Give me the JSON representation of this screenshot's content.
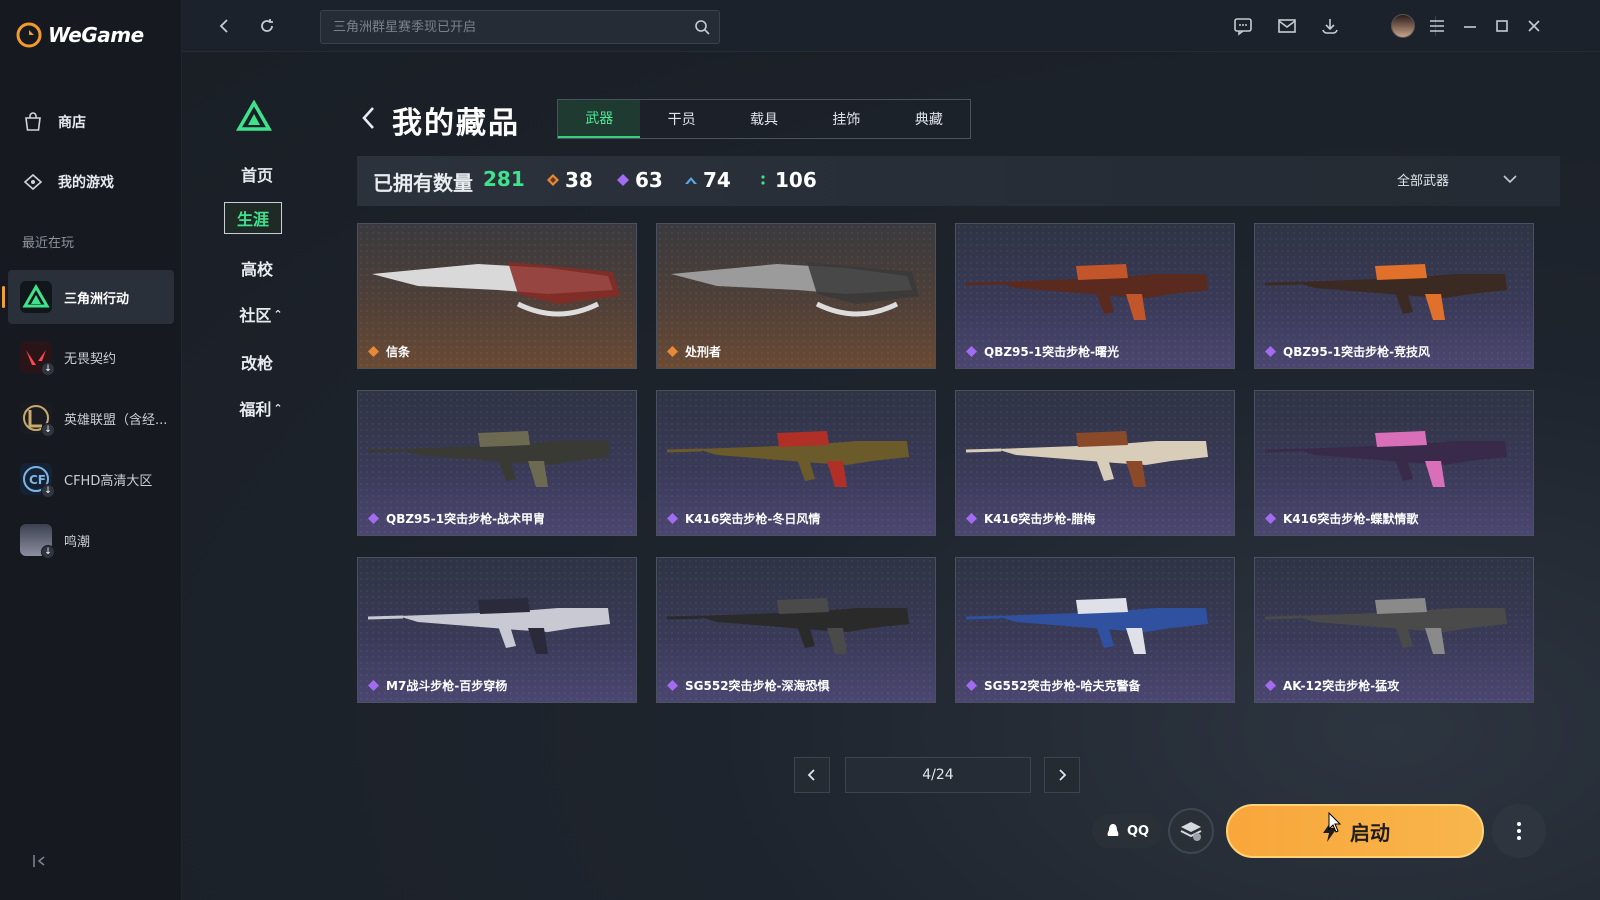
{
  "app": {
    "name": "WeGame"
  },
  "sidebar": {
    "store_label": "商店",
    "my_games_label": "我的游戏",
    "recent_label": "最近在玩",
    "games": [
      {
        "label": "三角洲行动",
        "active": true
      },
      {
        "label": "无畏契约"
      },
      {
        "label": "英雄联盟（含经..."
      },
      {
        "label": "CFHD高清大区"
      },
      {
        "label": "鸣潮"
      }
    ]
  },
  "topbar": {
    "search_placeholder": "三角洲群星赛季现已开启",
    "icons": [
      "back-icon",
      "refresh-icon",
      "chat-icon",
      "mail-icon",
      "download-icon",
      "avatar",
      "menu-icon",
      "minimize-icon",
      "maximize-icon",
      "close-icon"
    ]
  },
  "subnav": {
    "items": [
      "首页",
      "生涯",
      "高校",
      "社区",
      "改枪",
      "福利"
    ],
    "active": "生涯",
    "community_suffix": "⌃",
    "welfare_suffix": "⌃"
  },
  "collection": {
    "title": "我的藏品",
    "tabs": [
      "武器",
      "干员",
      "载具",
      "挂饰",
      "典藏"
    ],
    "active_tab": "武器",
    "owned_label": "已拥有数量",
    "owned_count": "281",
    "stats": [
      {
        "value": "38",
        "color": "#e8893a"
      },
      {
        "value": "63",
        "color": "#a36cf0"
      },
      {
        "value": "74",
        "color": "#5aa8e8"
      },
      {
        "value": "106",
        "color": "#3fe38b"
      }
    ],
    "filter_label": "全部武器",
    "items": [
      {
        "name": "信条",
        "rarity": "orange"
      },
      {
        "name": "处刑者",
        "rarity": "orange"
      },
      {
        "name": "QBZ95-1突击步枪-曙光",
        "rarity": "purple"
      },
      {
        "name": "QBZ95-1突击步枪-竞技风",
        "rarity": "purple"
      },
      {
        "name": "QBZ95-1突击步枪-战术甲胄",
        "rarity": "purple"
      },
      {
        "name": "K416突击步枪-冬日风情",
        "rarity": "purple"
      },
      {
        "name": "K416突击步枪-腊梅",
        "rarity": "purple"
      },
      {
        "name": "K416突击步枪-蝶默情歌",
        "rarity": "purple"
      },
      {
        "name": "M7战斗步枪-百步穿杨",
        "rarity": "purple"
      },
      {
        "name": "SG552突击步枪-深海恐惧",
        "rarity": "purple"
      },
      {
        "name": "SG552突击步枪-哈夫克警备",
        "rarity": "purple"
      },
      {
        "name": "AK-12突击步枪-猛攻",
        "rarity": "purple"
      }
    ],
    "pagination": "4/24"
  },
  "footer": {
    "qq_label": "QQ",
    "launch_label": "启动"
  },
  "colors": {
    "accent_green": "#3fe38b",
    "launch_orange": "#f9a63a",
    "orange_rarity": "#e8893a",
    "purple_rarity": "#a36cf0"
  }
}
